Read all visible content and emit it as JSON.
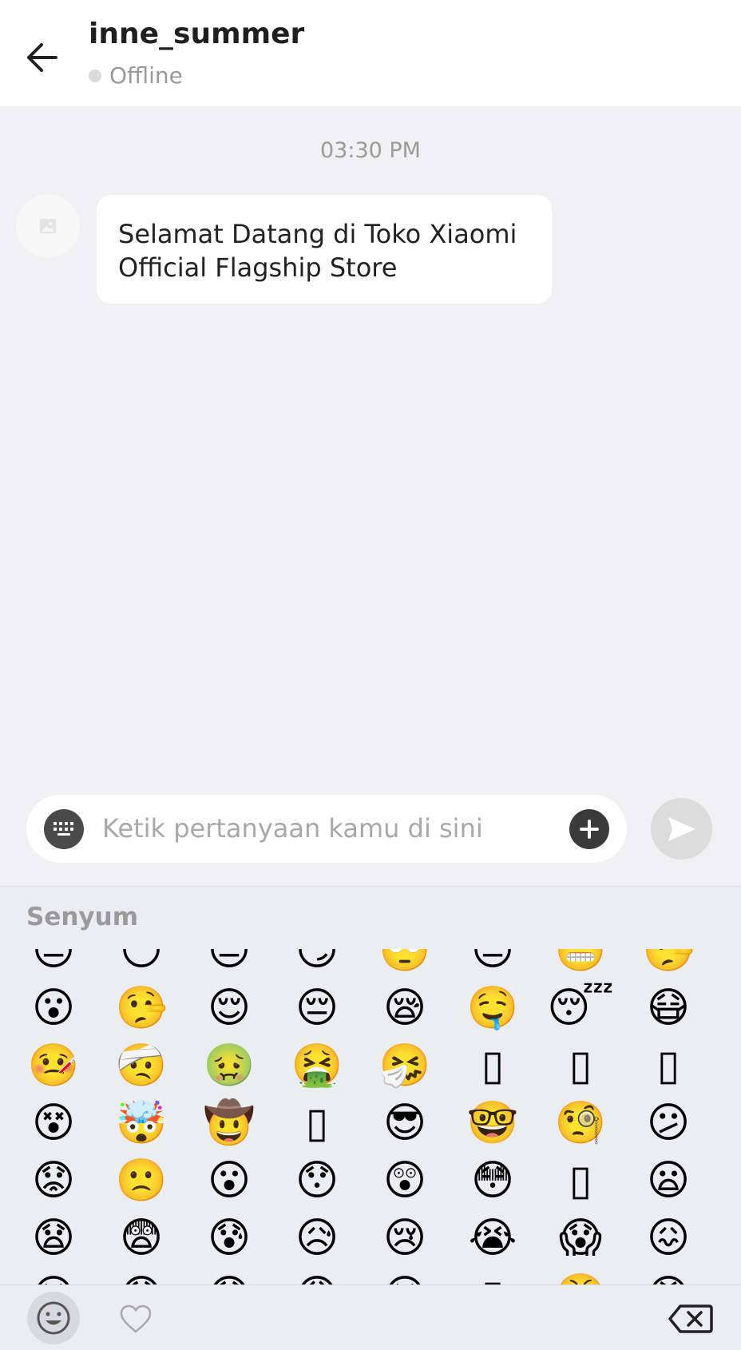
{
  "header": {
    "contact_name": "inne_summer",
    "status": "Offline",
    "back_icon": "arrow-left-icon"
  },
  "chat": {
    "timestamp": "03:30 PM",
    "messages": [
      {
        "sender": "store",
        "text": "Selamat Datang di Toko Xiaomi Official Flagship Store"
      }
    ]
  },
  "composer": {
    "placeholder": "Ketik pertanyaan kamu di sini",
    "value": "",
    "keyboard_icon": "keyboard-icon",
    "plus_icon": "plus-circle-icon",
    "send_icon": "send-icon"
  },
  "emoji_panel": {
    "category": "Senyum",
    "emojis": [
      "😑",
      "😶",
      "😐",
      "😏",
      "🙄",
      "😒",
      "😬",
      "🤥",
      "😮",
      "🤥",
      "😌",
      "😔",
      "😪",
      "🤤",
      "😴",
      "😷",
      "🤒",
      "🤕",
      "🤢",
      "🤮",
      "🤧",
      "▯",
      "▯",
      "▯",
      "😵",
      "🤯",
      "🤠",
      "▯",
      "😎",
      "🤓",
      "🧐",
      "😕",
      "😟",
      "🙁",
      "😮",
      "😯",
      "😲",
      "😳",
      "▯",
      "😦",
      "😧",
      "😨",
      "😰",
      "😥",
      "😢",
      "😭",
      "😱",
      "😖",
      "😣",
      "😞",
      "😓",
      "😩",
      "😫",
      "▯",
      "😤",
      "😡"
    ]
  },
  "toolbar": {
    "emoji_tab_icon": "smiley-icon",
    "favorites_icon": "heart-icon",
    "backspace_icon": "backspace-icon"
  },
  "colors": {
    "background": "#f1f1f3",
    "bubble": "#ffffff",
    "panel": "#ecedf1",
    "send_disabled": "#dcdcdd",
    "dark_icon": "#3a3a3a"
  }
}
